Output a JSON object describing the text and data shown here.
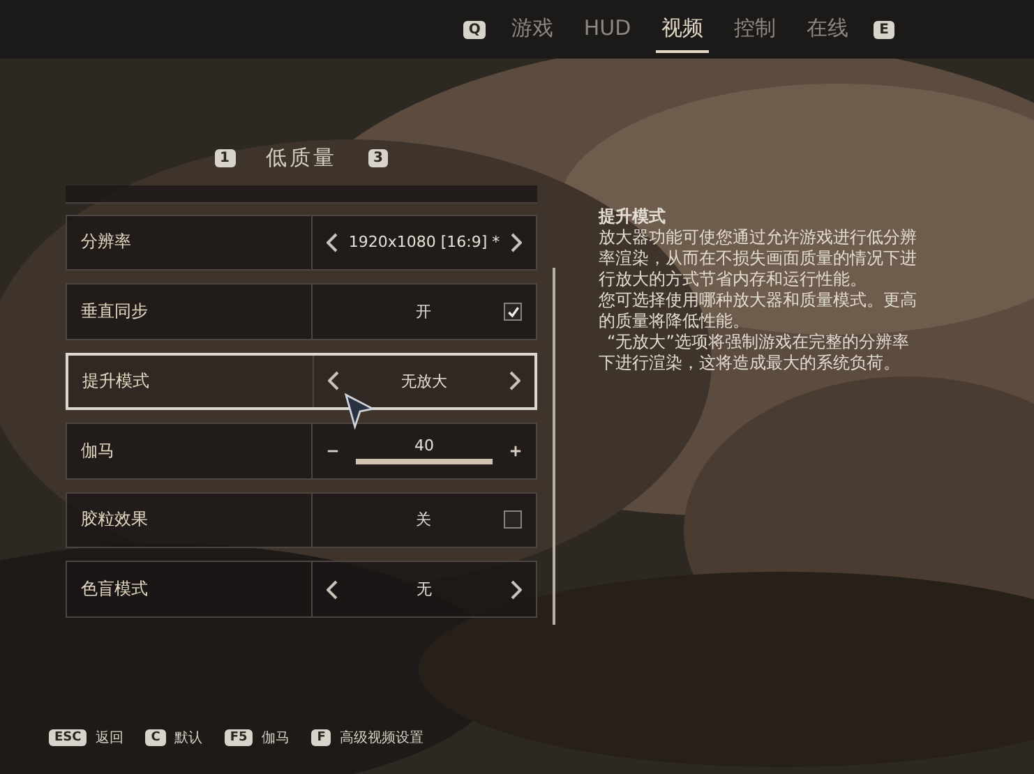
{
  "tabs": {
    "prev_key": "Q",
    "next_key": "E",
    "items": [
      {
        "label": "游戏",
        "selected": false
      },
      {
        "label": "HUD",
        "selected": false
      },
      {
        "label": "视频",
        "selected": true
      },
      {
        "label": "控制",
        "selected": false
      },
      {
        "label": "在线",
        "selected": false
      }
    ]
  },
  "preset": {
    "prev_key": "1",
    "label": "低质量",
    "next_key": "3"
  },
  "settings": [
    {
      "kind": "selector",
      "label": "分辨率",
      "value": "1920x1080 [16:9] *",
      "focused": false
    },
    {
      "kind": "toggle",
      "label": "垂直同步",
      "value": "开",
      "checked": true,
      "focused": false
    },
    {
      "kind": "selector",
      "label": "提升模式",
      "value": "无放大",
      "focused": true
    },
    {
      "kind": "slider",
      "label": "伽马",
      "value": "40",
      "level": 1,
      "focused": false
    },
    {
      "kind": "toggle",
      "label": "胶粒效果",
      "value": "关",
      "checked": false,
      "focused": false
    },
    {
      "kind": "selector",
      "label": "色盲模式",
      "value": "无",
      "focused": false
    }
  ],
  "description": {
    "title": "提升模式",
    "paragraphs": [
      "放大器功能可使您通过允许游戏进行低分辨率渲染，从而在不损失画面质量的情况下进行放大的方式节省内存和运行性能。",
      "您可选择使用哪种放大器和质量模式。更高的质量将降低性能。",
      "“无放大”选项将强制游戏在完整的分辨率下进行渲染，这将造成最大的系统负荷。"
    ]
  },
  "footer": [
    {
      "key": "ESC",
      "label": "返回"
    },
    {
      "key": "C",
      "label": "默认"
    },
    {
      "key": "F5",
      "label": "伽马"
    },
    {
      "key": "F",
      "label": "高级视频设置"
    }
  ]
}
